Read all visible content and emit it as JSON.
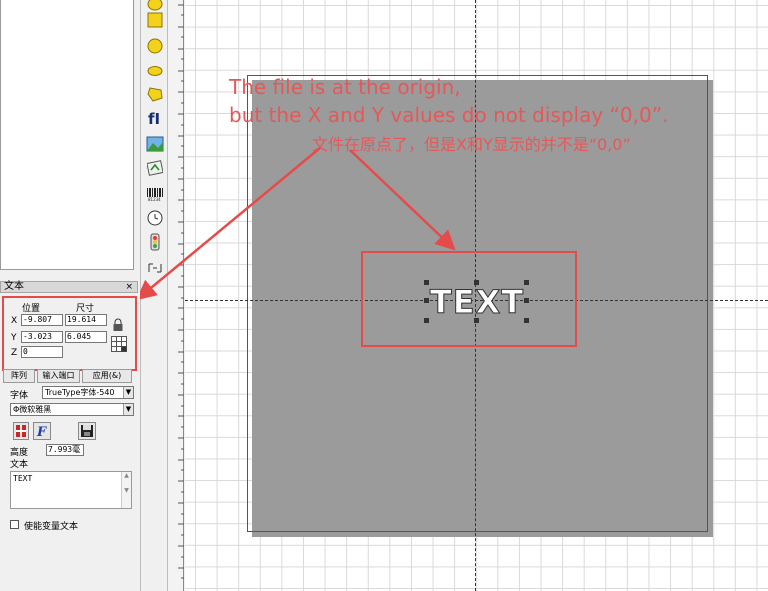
{
  "annotation": {
    "line1": "The file is at the origin,",
    "line2": "but the X and Y values do not display “0,0”.",
    "line_cn": "文件在原点了，但是X和Y显示的并不是“0,0”"
  },
  "canvas": {
    "object_text": "TEXT"
  },
  "props": {
    "title": "文本",
    "close": "×",
    "col_position": "位置",
    "col_size": "尺寸",
    "x_label": "X",
    "y_label": "Y",
    "z_label": "Z",
    "x_pos": "-9.807",
    "x_size": "19.614",
    "y_pos": "-3.023",
    "y_size": "6.045",
    "z_pos": "0",
    "btn_array": "阵列",
    "btn_input_port": "输入端口",
    "btn_apply": "应用(&)",
    "font_label": "字体",
    "font_type": "TrueType字体-540",
    "font_name": "Φ微软雅黑",
    "height_label": "高度",
    "height_value": "7.993毫",
    "text_label": "文本",
    "text_value": "TEXT",
    "variable_text": "使能变量文本"
  },
  "colors": {
    "annotation": "#e65858",
    "highlight": "#e64b4b"
  }
}
